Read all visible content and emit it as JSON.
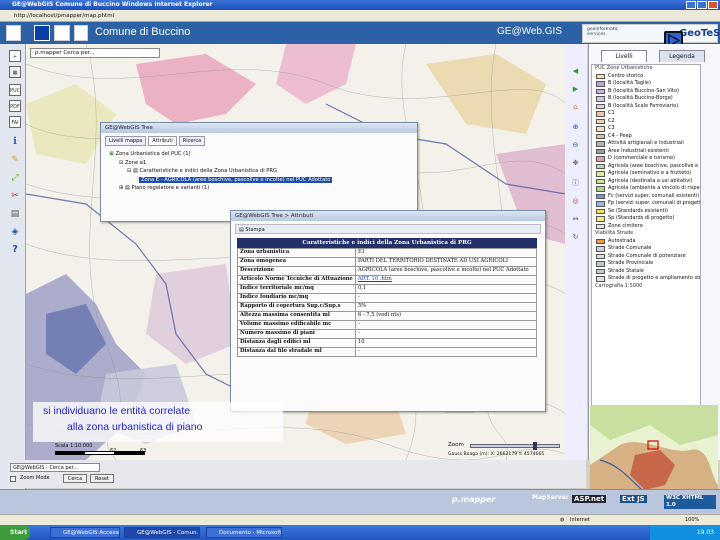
{
  "window": {
    "title": "GE@WebGIS   Comune di Buccino   Windows Internet Explorer",
    "address": "http://localhost/pmapper/map.phtml"
  },
  "header": {
    "app_title": "Comune di Buccino",
    "brand": "GE@Web.GIS",
    "geo_logo": "GeoTeSy",
    "geo_logo_sub": "geoinformatic services"
  },
  "map_selector": {
    "value": "p.mapper   Cerca per..."
  },
  "left_tools": [
    "PUC",
    "PDF",
    "FAI"
  ],
  "right_panel": {
    "tabs": [
      "Livelli",
      "Legenda"
    ],
    "groups": [
      {
        "name": "PUC Zone Urbanistiche",
        "items": [
          {
            "label": "Centro storico",
            "color": "#f4e3a0"
          },
          {
            "label": "B (località Taglie)",
            "color": "#b7a6d6"
          },
          {
            "label": "B (località Buccino-San Vito)",
            "color": "#c9b3e2"
          },
          {
            "label": "B (località Buccino-Borgo)",
            "color": "#d6c4ea"
          },
          {
            "label": "B (località Scalo Ferroviario)",
            "color": "#e0d0f0"
          },
          {
            "label": "C1",
            "color": "#f3c6a2"
          },
          {
            "label": "C2",
            "color": "#f6d2b5"
          },
          {
            "label": "C3",
            "color": "#f8dcc6"
          },
          {
            "label": "C4 - Peep",
            "color": "#f1b88c"
          },
          {
            "label": "Attività artigianali e industriali",
            "color": "#b5b5b5"
          },
          {
            "label": "Aree Industriali esistenti",
            "color": "#9c9c9c"
          },
          {
            "label": "D (commerciale e turismo)",
            "color": "#e3a0a8"
          },
          {
            "label": "Agricola (aree boschive, pascolive e incolte)",
            "color": "#b6dca2"
          },
          {
            "label": "Agricola (seminativo e a frutteto)",
            "color": "#d8ee9a"
          },
          {
            "label": "Agricola (destinata a usi abitativi)",
            "color": "#c8e48a"
          },
          {
            "label": "Agricola (ambiente a vincolo di rispetto ambientale)",
            "color": "#a8d88e"
          },
          {
            "label": "Fc (servizi super. comunali esistenti)",
            "color": "#6e9ad6"
          },
          {
            "label": "Fp (servizi super. comunali di progetto)",
            "color": "#9ab8e6"
          },
          {
            "label": "Se (Standards esistenti)",
            "color": "#f2e24a"
          },
          {
            "label": "Sp (Standards di progetto)",
            "color": "#f6ea82"
          },
          {
            "label": "Zone cimitero",
            "color": "#e8e8e8"
          }
        ]
      },
      {
        "name": "Viabilità Strade",
        "items": [
          {
            "label": "Autostrada",
            "color": "#f29a3a"
          },
          {
            "label": "Strade Comunale",
            "color": "#c8d2e0"
          },
          {
            "label": "Strade Comunale di potenziare",
            "color": "#d6dde8"
          },
          {
            "label": "Strade Provinciale",
            "color": "#bfc8d8"
          },
          {
            "label": "Strade Statale",
            "color": "#c0ccdc"
          },
          {
            "label": "Strade di progetto e ampliamento stradale",
            "color": "#e0e0e0"
          }
        ]
      },
      {
        "name": "Cartografia 1:5000",
        "items": []
      }
    ]
  },
  "tree_window": {
    "title": "GE@WebGIS Tree",
    "tabs": [
      "Livelli mappa",
      "Attributi",
      "Ricerca"
    ],
    "nodes": [
      "Zona Urbanistica del PUC (1)",
      "Zone e1",
      "Caratteristiche e indici della Zona Urbanistica di PRG",
      "Zona E - AGRICOLA (aree boschive, pascolive e incolte) nel PUC Adottato",
      "Piano regolatore e varianti (1)"
    ]
  },
  "attr_window": {
    "title": "GE@WebGIS Tree > Attributi",
    "toolbar_button": "Stampa",
    "table_title": "Caratteristiche e indici della Zona Urbanistica di PRG",
    "rows": [
      {
        "key": "Zona urbanistica",
        "value": "E1"
      },
      {
        "key": "Zona omogenea",
        "value": "PARTI DEL TERRITORIO DESTINATE AD USI AGRICOLI"
      },
      {
        "key": "Descrizione",
        "value": "AGRICOLA (aree boschive, pascolive e incolte) nel PUC Adottato"
      },
      {
        "key": "Articolo Norme Tecniche di Attuazione",
        "value": "ART. 10 .htm"
      },
      {
        "key": "Indice territoriale mc/mq",
        "value": "0,1"
      },
      {
        "key": "Indice fondiario mc/mq",
        "value": "-"
      },
      {
        "key": "Rapporto di copertura Sup.c/Sup.s",
        "value": "5%"
      },
      {
        "key": "Altezza massima consentita ml",
        "value": "6 - 7,5 (vedi nts)"
      },
      {
        "key": "Volume massimo edificabile mc",
        "value": "-"
      },
      {
        "key": "Numero massimo di piani",
        "value": "-"
      },
      {
        "key": "Distanza dagli edifici ml",
        "value": "10"
      },
      {
        "key": "Distanza dal filo stradale ml",
        "value": "-"
      }
    ]
  },
  "caption": {
    "line1": "si individuano le entità correlate",
    "line2": "alla zona urbanistica di piano"
  },
  "scalebar": {
    "label": "Scala 1:10.000",
    "ticks": [
      "0",
      "62",
      "63"
    ]
  },
  "zoom": {
    "label": "Zoom",
    "coords": "Gauss Boaga (m): X: 2662179  Y: 4574665"
  },
  "status": {
    "search_select": "GE@WebGIS - Cerca per...",
    "zoom_mode": "Zoom Mode",
    "cerca_button": "Cerca",
    "reset_button": "Reset"
  },
  "footer": {
    "badges": [
      "p.mapper",
      "MapServer",
      "ASP.net",
      "Ext JS",
      "W3C XHTML 1.0"
    ]
  },
  "ie_status": {
    "zone": "Internet",
    "zoom": "100%"
  },
  "taskbar": {
    "start": "Start",
    "tasks": [
      "GE@WebGIS Accessible...",
      "GE@WebGIS - Comun...",
      "Documento - Microsoft..."
    ],
    "clock": "19.03"
  }
}
